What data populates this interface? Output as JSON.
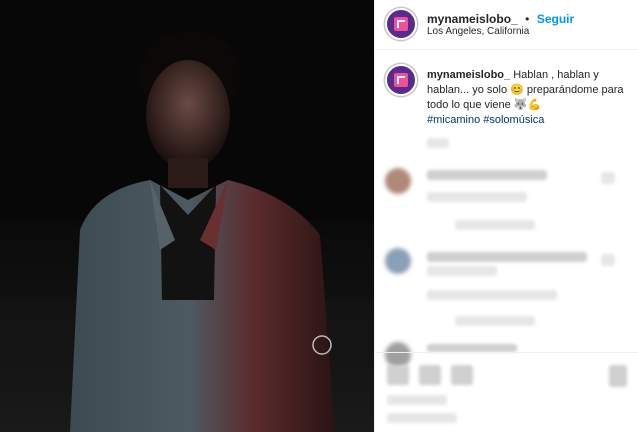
{
  "post": {
    "username": "mynameislobo_",
    "separator": "•",
    "follow_label": "Seguir",
    "location": "Los Angeles, California"
  },
  "caption": {
    "username": "mynameislobo_",
    "text": " Hablan , hablan y hablan... yo solo 😊 preparándome para todo lo que viene 🐺💪",
    "hashtags": "#micamino #solomúsica"
  },
  "icons": {
    "avatar": "avatar-logo-icon",
    "like": "heart-icon",
    "comment": "comment-icon",
    "share": "share-icon",
    "save": "bookmark-icon"
  },
  "colors": {
    "follow": "#0095f6",
    "hashtag": "#00376b",
    "avatar_bg": "#5a2a8c",
    "avatar_logo": "#f04f9a"
  }
}
